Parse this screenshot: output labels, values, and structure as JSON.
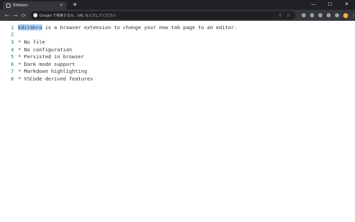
{
  "browser": {
    "tab": {
      "title": "Editabro",
      "close": "×"
    },
    "new_tab": "+",
    "window_controls": {
      "minimize": "—",
      "maximize": "☐",
      "close": "✕"
    },
    "nav": {
      "back": "←",
      "forward": "→",
      "reload": "⟳"
    },
    "omnibox": {
      "placeholder": "Google で検索するか、URL を入力してください"
    },
    "omni_actions": [
      "⇪",
      "☆"
    ]
  },
  "editor": {
    "lines": [
      {
        "num": "1",
        "selected": "Editabro",
        "text": " is a browser extension to change your new tab page to an editor."
      },
      {
        "num": "2",
        "text": ""
      },
      {
        "num": "3",
        "text": "* No file"
      },
      {
        "num": "4",
        "text": "* No configuration"
      },
      {
        "num": "5",
        "text": "* Persisted in browser"
      },
      {
        "num": "6",
        "text": "* Dark mode support"
      },
      {
        "num": "7",
        "text": "* Markdown highlighting"
      },
      {
        "num": "8",
        "text": "* VSCode derived features"
      }
    ]
  },
  "colors": {
    "tabstrip": "#202124",
    "toolbar": "#35363a",
    "line_number": "#237893",
    "selection": "#add6ff"
  }
}
